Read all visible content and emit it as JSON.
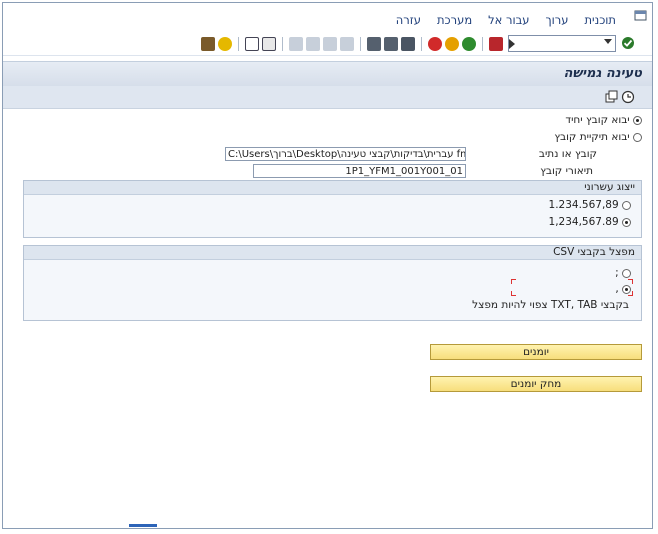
{
  "menu": {
    "items": [
      "תוכנית",
      "ערוך",
      "עבור אל",
      "מערכת",
      "עזרה"
    ]
  },
  "toolbar": {
    "command_field_value": ""
  },
  "title": "טעינה גמישה",
  "options": {
    "import_single_file": "יבוא קובץ יחיד",
    "import_folder": "יבוא תיקיית קובץ",
    "file_path_label": "קובץ או נתיב",
    "file_path_value": "C:\\Users\\ברוך\\Desktop\\עברית\\בדיקות\\קבצי טעינה fm co",
    "file_desc_label": "תיאורי קובץ",
    "file_desc_value": "1P1_YFM1_001Y001_01"
  },
  "decimal_group": {
    "title": "ייצוג עשרוני",
    "option1": "1.234.567,89",
    "option2": "1,234,567.89"
  },
  "csv_group": {
    "title": "מפצל בקבצי CSV",
    "option1": ";",
    "option2": ",",
    "note": "בקבצי TXT, TAB צפוי להיות מפצל"
  },
  "buttons": {
    "logs": "יומנים",
    "delete_logs": "מחק יומנים"
  },
  "colors": {
    "accent": "#1f3f7a",
    "button": "#f7de7c",
    "title_bg": "#d6deea"
  }
}
